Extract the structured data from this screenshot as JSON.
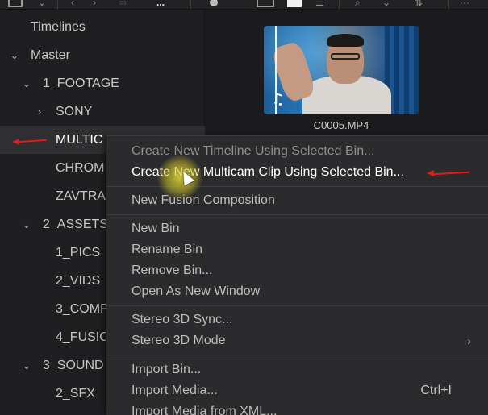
{
  "toolbar": {
    "icons": [
      "panel-layout-icon",
      "chevron-down-icon",
      "back-icon",
      "forward-icon",
      "link-icon",
      "more-icon",
      "dot-icon",
      "list-view-icon",
      "grid-view-icon",
      "metadata-view-icon",
      "search-icon",
      "sort-icon",
      "options-icon"
    ]
  },
  "sidebar": {
    "items": [
      {
        "label": "Timelines",
        "chevron": ""
      },
      {
        "label": "Master",
        "chevron": "⌄"
      },
      {
        "label": "1_FOOTAGE",
        "chevron": "⌄"
      },
      {
        "label": "SONY",
        "chevron": "›"
      },
      {
        "label": "MULTIC",
        "chevron": ""
      },
      {
        "label": "CHROM",
        "chevron": ""
      },
      {
        "label": "ZAVTRA",
        "chevron": ""
      },
      {
        "label": "2_ASSETS",
        "chevron": "⌄"
      },
      {
        "label": "1_PICS",
        "chevron": ""
      },
      {
        "label": "2_VIDS",
        "chevron": ""
      },
      {
        "label": "3_COMP",
        "chevron": ""
      },
      {
        "label": "4_FUSIO",
        "chevron": ""
      },
      {
        "label": "3_SOUND",
        "chevron": "⌄"
      },
      {
        "label": "2_SFX",
        "chevron": ""
      },
      {
        "label": "",
        "chevron": ""
      }
    ]
  },
  "media_pool": {
    "clip_name": "C0005.MP4",
    "clip_icon": "♫"
  },
  "context_menu": {
    "items": [
      {
        "label": "Create New Timeline Using Selected Bin...",
        "shortcut": "",
        "submenu": ""
      },
      {
        "label": "Create New Multicam Clip Using Selected Bin...",
        "shortcut": "",
        "submenu": ""
      },
      {
        "label": "New Fusion Composition",
        "shortcut": "",
        "submenu": ""
      },
      {
        "label": "New Bin",
        "shortcut": "",
        "submenu": ""
      },
      {
        "label": "Rename Bin",
        "shortcut": "",
        "submenu": ""
      },
      {
        "label": "Remove Bin...",
        "shortcut": "",
        "submenu": ""
      },
      {
        "label": "Open As New Window",
        "shortcut": "",
        "submenu": ""
      },
      {
        "label": "Stereo 3D Sync...",
        "shortcut": "",
        "submenu": ""
      },
      {
        "label": "Stereo 3D Mode",
        "shortcut": "",
        "submenu": "›"
      },
      {
        "label": "Import Bin...",
        "shortcut": "",
        "submenu": ""
      },
      {
        "label": "Import Media...",
        "shortcut": "Ctrl+I",
        "submenu": ""
      },
      {
        "label": "Import Media from XML...",
        "shortcut": "",
        "submenu": ""
      }
    ]
  },
  "colors": {
    "annotation_arrow": "#e21a1a",
    "cursor_highlight": "#e6dc3c"
  }
}
